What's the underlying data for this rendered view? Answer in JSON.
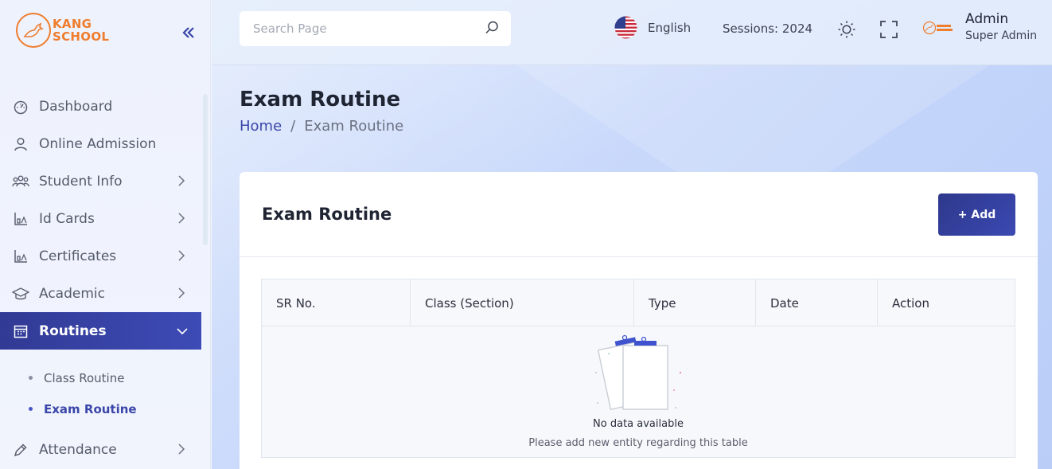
{
  "brand": {
    "line1": "KANG",
    "line2": "SCHOOL"
  },
  "search": {
    "placeholder": "Search Page"
  },
  "topbar": {
    "language": "English",
    "session": "Sessions: 2024",
    "user_name": "Admin",
    "user_role": "Super Admin"
  },
  "sidebar": {
    "items": [
      {
        "label": "Dashboard"
      },
      {
        "label": "Online Admission"
      },
      {
        "label": "Student Info"
      },
      {
        "label": "Id Cards"
      },
      {
        "label": "Certificates"
      },
      {
        "label": "Academic"
      },
      {
        "label": "Routines"
      },
      {
        "label": "Attendance"
      }
    ],
    "routines_sub": [
      {
        "label": "Class Routine"
      },
      {
        "label": "Exam Routine"
      }
    ]
  },
  "page": {
    "title": "Exam Routine",
    "breadcrumb_home": "Home",
    "breadcrumb_sep": "/",
    "breadcrumb_current": "Exam Routine"
  },
  "card": {
    "title": "Exam Routine",
    "add_label": "+ Add",
    "columns": [
      "SR No.",
      "Class (Section)",
      "Type",
      "Date",
      "Action"
    ],
    "empty_title": "No data available",
    "empty_subtitle": "Please add new entity regarding this table"
  },
  "colors": {
    "accent": "#3a46a8",
    "brand_orange": "#ee7d2e",
    "active_nav": "#313a94"
  },
  "icons": {
    "dashboard": "gauge-icon",
    "admission": "user-icon",
    "students": "users-icon",
    "idcards": "chart-icon",
    "certificates": "chart-icon",
    "academic": "graduation-cap-icon",
    "routines": "calendar-icon",
    "attendance": "pen-icon"
  }
}
